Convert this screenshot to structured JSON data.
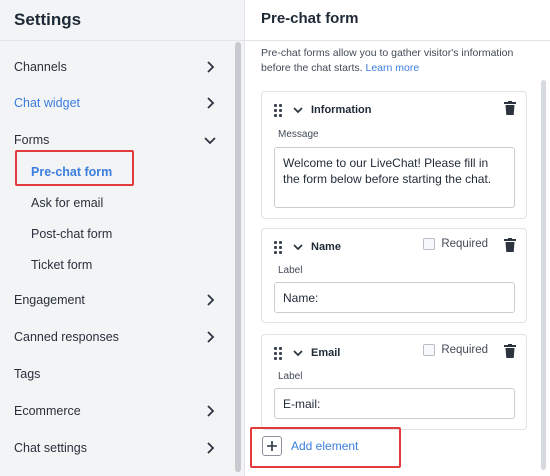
{
  "sidebar": {
    "title": "Settings",
    "items": [
      {
        "label": "Channels",
        "chevron": "right",
        "active": false
      },
      {
        "label": "Chat widget",
        "chevron": "right",
        "active": true
      },
      {
        "label": "Forms",
        "chevron": "down",
        "active": false
      },
      {
        "label": "Pre-chat form",
        "chevron": "",
        "active": true,
        "sub": true
      },
      {
        "label": "Ask for email",
        "chevron": "",
        "active": false,
        "sub": true
      },
      {
        "label": "Post-chat form",
        "chevron": "",
        "active": false,
        "sub": true
      },
      {
        "label": "Ticket form",
        "chevron": "",
        "active": false,
        "sub": true
      },
      {
        "label": "Engagement",
        "chevron": "right",
        "active": false
      },
      {
        "label": "Canned responses",
        "chevron": "right",
        "active": false
      },
      {
        "label": "Tags",
        "chevron": "",
        "active": false
      },
      {
        "label": "Ecommerce",
        "chevron": "right",
        "active": false
      },
      {
        "label": "Chat settings",
        "chevron": "right",
        "active": false
      }
    ]
  },
  "main": {
    "title": "Pre-chat form",
    "description": "Pre-chat forms allow you to gather visitor's information before the chat starts.",
    "learn_more": "Learn more",
    "cards": [
      {
        "name": "Information",
        "field_label": "Message",
        "value": "Welcome to our LiveChat! Please fill in the form below before starting the chat.",
        "required": null
      },
      {
        "name": "Name",
        "field_label": "Label",
        "value": "Name:",
        "required": "Required"
      },
      {
        "name": "Email",
        "field_label": "Label",
        "value": "E-mail:",
        "required": "Required"
      }
    ],
    "add_element": "Add element"
  },
  "colors": {
    "accent": "#3b7ede",
    "highlight": "#e23b3b",
    "sidebar_bg": "#f3f4f6"
  },
  "icons": [
    "chevron-right-icon",
    "chevron-down-icon",
    "drag-handle-icon",
    "trash-icon",
    "plus-icon"
  ]
}
